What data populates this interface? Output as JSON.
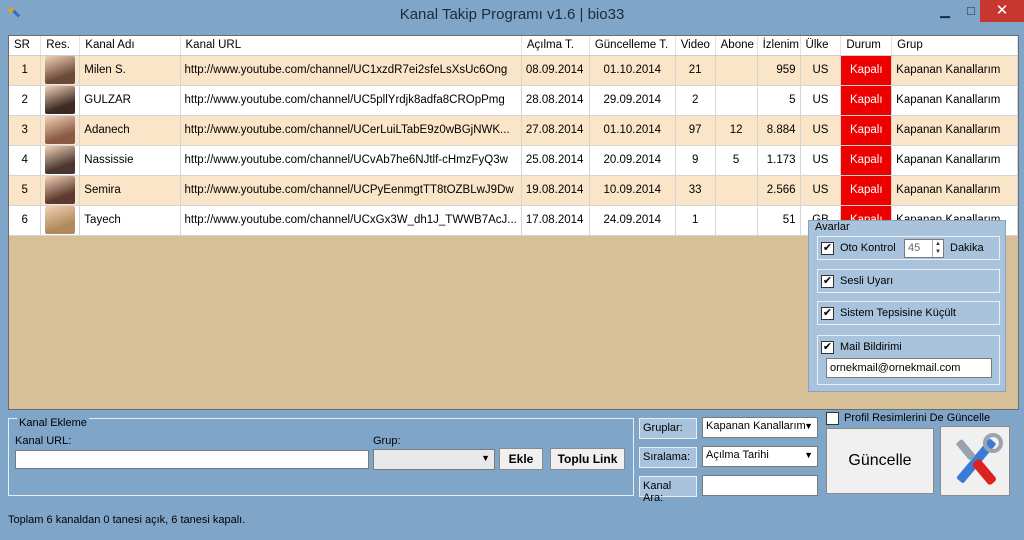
{
  "window": {
    "title": "Kanal Takip Programı v1.6 | bio33",
    "min_glyph": "▁",
    "max_glyph": "□",
    "close_glyph": "✕"
  },
  "table": {
    "headers": [
      "SR",
      "Res.",
      "Kanal Adı",
      "Kanal URL",
      "Açılma T.",
      "Güncelleme T.",
      "Video",
      "Abone",
      "İzlenim",
      "Ülke",
      "Durum",
      "Grup"
    ],
    "rows": [
      {
        "sr": "1",
        "avatar_color": "#6b4a3a",
        "name": "Milen S.",
        "url": "http://www.youtube.com/channel/UC1xzdR7ei2sfeLsXsUc6Ong",
        "opened": "08.09.2014",
        "updated": "01.10.2014",
        "video": "21",
        "subs": "",
        "views": "959",
        "country": "US",
        "status": "Kapalı",
        "group": "Kapanan Kanallarım"
      },
      {
        "sr": "2",
        "avatar_color": "#3c2a24",
        "name": "GULZAR",
        "url": "http://www.youtube.com/channel/UC5pllYrdjk8adfa8CROpPmg",
        "opened": "28.08.2014",
        "updated": "29.09.2014",
        "video": "2",
        "subs": "",
        "views": "5",
        "country": "US",
        "status": "Kapalı",
        "group": "Kapanan Kanallarım"
      },
      {
        "sr": "3",
        "avatar_color": "#8a5a44",
        "name": "Adanech",
        "url": "http://www.youtube.com/channel/UCerLuiLTabE9z0wBGjNWK...",
        "opened": "27.08.2014",
        "updated": "01.10.2014",
        "video": "97",
        "subs": "12",
        "views": "8.884",
        "country": "US",
        "status": "Kapalı",
        "group": "Kapanan Kanallarım"
      },
      {
        "sr": "4",
        "avatar_color": "#4a3530",
        "name": "Nassissie",
        "url": "http://www.youtube.com/channel/UCvAb7he6NJtlf-cHmzFyQ3w",
        "opened": "25.08.2014",
        "updated": "20.09.2014",
        "video": "9",
        "subs": "5",
        "views": "1.173",
        "country": "US",
        "status": "Kapalı",
        "group": "Kapanan Kanallarım"
      },
      {
        "sr": "5",
        "avatar_color": "#5c3a30",
        "name": "Semira",
        "url": "http://www.youtube.com/channel/UCPyEenmgtTT8tOZBLwJ9Dw",
        "opened": "19.08.2014",
        "updated": "10.09.2014",
        "video": "33",
        "subs": "",
        "views": "2.566",
        "country": "US",
        "status": "Kapalı",
        "group": "Kapanan Kanallarım"
      },
      {
        "sr": "6",
        "avatar_color": "#b08a5a",
        "name": "Tayech",
        "url": "http://www.youtube.com/channel/UCxGx3W_dh1J_TWWB7AcJ...",
        "opened": "17.08.2014",
        "updated": "24.09.2014",
        "video": "1",
        "subs": "",
        "views": "51",
        "country": "GB",
        "status": "Kapalı",
        "group": "Kapanan Kanallarım"
      }
    ]
  },
  "settings": {
    "legend": "Avarlar",
    "oto_kontrol": {
      "label": "Oto Kontrol",
      "checked": true,
      "value": "45",
      "unit": "Dakika"
    },
    "sesli_uyari": {
      "label": "Sesli Uyarı",
      "checked": true
    },
    "tepsi": {
      "label": "Sistem Tepsisine Küçült",
      "checked": true
    },
    "mail": {
      "label": "Mail Bildirimi",
      "checked": true,
      "value": "ornekmail@ornekmail.com"
    },
    "check_glyph": "✔"
  },
  "add_channel": {
    "legend": "Kanal Ekleme",
    "url_label": "Kanal URL:",
    "url_value": "",
    "group_label": "Grup:",
    "group_value": "",
    "add_button": "Ekle",
    "bulk_button": "Toplu Link"
  },
  "filters": {
    "groups_label": "Gruplar:",
    "groups_value": "Kapanan Kanallarım",
    "sort_label": "Sıralama:",
    "sort_value": "Açılma Tarihi",
    "search_label": "Kanal Ara:",
    "search_value": ""
  },
  "profile_update": {
    "label": "Profil Resimlerini De Güncelle",
    "checked": false
  },
  "update_button": "Güncelle",
  "status": "Toplam 6 kanaldan 0 tanesi açık, 6 tanesi kapalı.",
  "colors": {
    "window_bg": "#7fa6c9",
    "grid_bg": "#d7bf98",
    "row_odd": "#fbe5c8",
    "status_closed": "#ee0000",
    "close_button": "#c7372f"
  }
}
